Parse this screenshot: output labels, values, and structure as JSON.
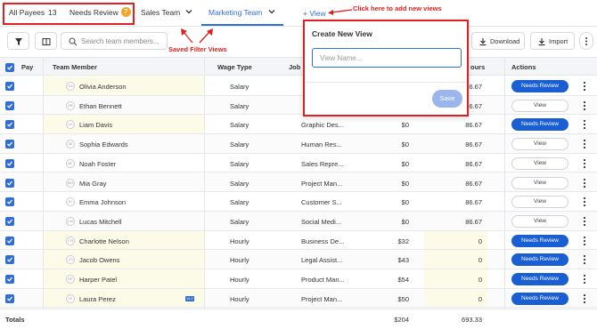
{
  "tabs": {
    "all_payees": "All Payees",
    "all_payees_count": "13",
    "needs_review": "Needs Review",
    "needs_review_count": "7",
    "sales_team": "Sales Team",
    "marketing_team": "Marketing Team",
    "add_view": "+ View"
  },
  "annotations": {
    "add_views": "Click here to add new views",
    "saved_views": "Saved Filter Views"
  },
  "toolbar": {
    "search_placeholder": "Search team members...",
    "download_label": "Download",
    "import_label": "Import"
  },
  "table": {
    "columns": {
      "pay": "Pay",
      "team_member": "Team Member",
      "wage_type": "Wage Type",
      "job": "Job",
      "hours": "ours",
      "actions": "Actions"
    },
    "rows": [
      {
        "initials": "OA",
        "name": "Olivia Anderson",
        "wage": "Salary",
        "job": "",
        "rate": "",
        "hours": "86.67",
        "action": "Needs Review"
      },
      {
        "initials": "EB",
        "name": "Ethan Bennett",
        "wage": "Salary",
        "job": "",
        "rate": "",
        "hours": "86.67",
        "action": "View"
      },
      {
        "initials": "LD",
        "name": "Liam Davis",
        "wage": "Salary",
        "job": "Graphic Des...",
        "rate": "$0",
        "hours": "86.67",
        "action": "Needs Review"
      },
      {
        "initials": "SE",
        "name": "Sophia Edwards",
        "wage": "Salary",
        "job": "Human Res...",
        "rate": "$0",
        "hours": "86.67",
        "action": "View"
      },
      {
        "initials": "NF",
        "name": "Noah Foster",
        "wage": "Salary",
        "job": "Sales Repre...",
        "rate": "$0",
        "hours": "86.67",
        "action": "View"
      },
      {
        "initials": "MG",
        "name": "Mia Gray",
        "wage": "Salary",
        "job": "Project Man...",
        "rate": "$0",
        "hours": "86.67",
        "action": "View"
      },
      {
        "initials": "EJ",
        "name": "Emma Johnson",
        "wage": "Salary",
        "job": "Customer S...",
        "rate": "$0",
        "hours": "86.67",
        "action": "View"
      },
      {
        "initials": "LM",
        "name": "Lucas Mitchell",
        "wage": "Salary",
        "job": "Social Medi...",
        "rate": "$0",
        "hours": "86.67",
        "action": "View"
      },
      {
        "initials": "CN",
        "name": "Charlotte Nelson",
        "wage": "Hourly",
        "job": "Business De...",
        "rate": "$32",
        "hours": "0",
        "action": "Needs Review"
      },
      {
        "initials": "JO",
        "name": "Jacob Owens",
        "wage": "Hourly",
        "job": "Legal Assist...",
        "rate": "$43",
        "hours": "0",
        "action": "Needs Review"
      },
      {
        "initials": "HP",
        "name": "Harper Patel",
        "wage": "Hourly",
        "job": "Product Man...",
        "rate": "$54",
        "hours": "0",
        "action": "Needs Review"
      },
      {
        "initials": "LP",
        "name": "Laura Perez",
        "wage": "Hourly",
        "job": "Project Man...",
        "rate": "$50",
        "hours": "0",
        "action": "Needs Review"
      }
    ],
    "totals_label": "Totals",
    "totals_rate": "$204",
    "totals_hours": "693.33",
    "mini_badge": "W-2"
  },
  "popup": {
    "title": "Create New View",
    "placeholder": "View Name...",
    "save": "Save"
  },
  "colors": {
    "accent": "#2f6ed8",
    "annotation": "#e02020",
    "badge": "#f4a62a",
    "highlight": "#fcfbe7"
  }
}
